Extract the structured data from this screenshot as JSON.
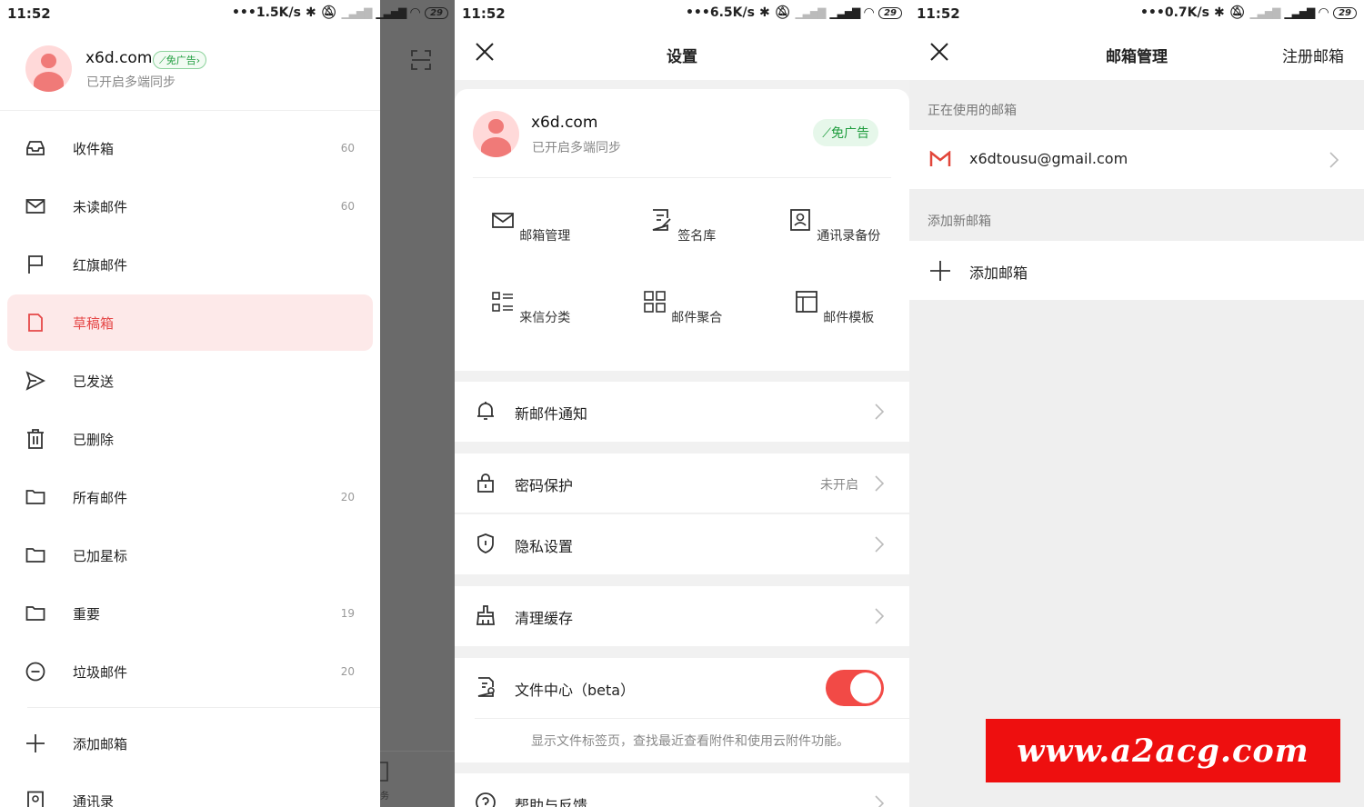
{
  "panel1": {
    "status": {
      "time": "11:52",
      "speed": "1.5K/s",
      "battery": "29"
    },
    "profile": {
      "name": "x6d.com",
      "badge": "免广告",
      "subtitle": "已开启多端同步"
    },
    "menu": [
      {
        "label": "收件箱",
        "count": "60",
        "icon": "inbox-icon"
      },
      {
        "label": "未读邮件",
        "count": "60",
        "icon": "envelope-icon"
      },
      {
        "label": "红旗邮件",
        "count": "",
        "icon": "flag-icon"
      },
      {
        "label": "草稿箱",
        "count": "",
        "icon": "draft-icon"
      },
      {
        "label": "已发送",
        "count": "",
        "icon": "send-icon"
      },
      {
        "label": "已删除",
        "count": "",
        "icon": "trash-icon"
      },
      {
        "label": "所有邮件",
        "count": "20",
        "icon": "folder-icon"
      },
      {
        "label": "已加星标",
        "count": "",
        "icon": "folder-icon"
      },
      {
        "label": "重要",
        "count": "19",
        "icon": "folder-icon"
      },
      {
        "label": "垃圾邮件",
        "count": "20",
        "icon": "spam-icon"
      }
    ],
    "extra": [
      {
        "label": "添加邮箱",
        "icon": "plus-icon"
      },
      {
        "label": "通讯录",
        "icon": "contacts-icon"
      }
    ],
    "overlay_tab": "务",
    "active_color": "#e54848"
  },
  "panel2": {
    "status": {
      "time": "11:52",
      "speed": "6.5K/s",
      "battery": "29"
    },
    "title": "设置",
    "profile": {
      "name": "x6d.com",
      "badge": "免广告",
      "subtitle": "已开启多端同步"
    },
    "grid": [
      {
        "label": "邮箱管理",
        "icon": "mailbox-icon"
      },
      {
        "label": "签名库",
        "icon": "signature-icon"
      },
      {
        "label": "通讯录备份",
        "icon": "contact-backup-icon"
      },
      {
        "label": "来信分类",
        "icon": "category-icon"
      },
      {
        "label": "邮件聚合",
        "icon": "aggregate-icon"
      },
      {
        "label": "邮件模板",
        "icon": "template-icon"
      }
    ],
    "rows": {
      "notify": "新邮件通知",
      "password": "密码保护",
      "password_value": "未开启",
      "privacy": "隐私设置",
      "cache": "清理缓存",
      "files": "文件中心（beta）",
      "files_desc": "显示文件标签页，查找最近查看附件和使用云附件功能。",
      "help": "帮助与反馈"
    },
    "toggle_on": true,
    "toggle_color": "#f24a46"
  },
  "panel3": {
    "status": {
      "time": "11:52",
      "speed": "0.7K/s",
      "battery": "29"
    },
    "title": "邮箱管理",
    "register": "注册邮箱",
    "in_use_label": "正在使用的邮箱",
    "account": "x6dtousu@gmail.com",
    "add_section": "添加新邮箱",
    "add_label": "添加邮箱",
    "watermark": "www.a2acg.com"
  }
}
